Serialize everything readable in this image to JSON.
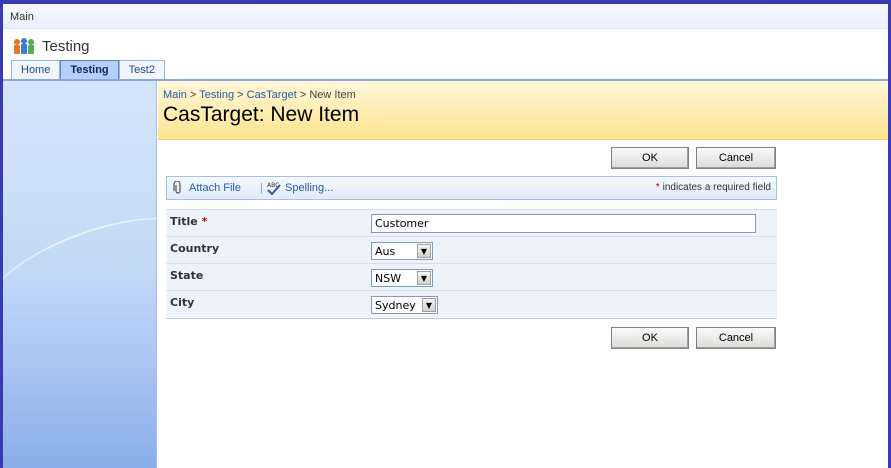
{
  "topbar": {
    "label": "Main"
  },
  "site": {
    "title": "Testing"
  },
  "tabs": [
    {
      "label": "Home"
    },
    {
      "label": "Testing"
    },
    {
      "label": "Test2"
    }
  ],
  "breadcrumb": {
    "items": [
      "Main",
      "Testing",
      "CasTarget",
      "New Item"
    ],
    "separator": ">"
  },
  "page": {
    "title": "CasTarget: New Item"
  },
  "buttons": {
    "ok": "OK",
    "cancel": "Cancel"
  },
  "toolbar": {
    "attach_file": "Attach File",
    "separator": "|",
    "spelling": "Spelling...",
    "required_star": "*",
    "required_note": "indicates a required field"
  },
  "form": {
    "title": {
      "label": "Title",
      "required_star": "*",
      "value": "Customer"
    },
    "country": {
      "label": "Country",
      "value": "Aus"
    },
    "state": {
      "label": "State",
      "value": "NSW"
    },
    "city": {
      "label": "City",
      "value": "Sydney"
    }
  },
  "icons": {
    "site": "site-people-icon",
    "attach": "paperclip-icon",
    "spelling": "spellcheck-icon",
    "dropdown": "dropdown-arrow-icon"
  },
  "colors": {
    "link": "#2a5ca8",
    "required": "#cc0000",
    "title_band": "#fde48f",
    "left_panel": "#c3d8f7"
  }
}
